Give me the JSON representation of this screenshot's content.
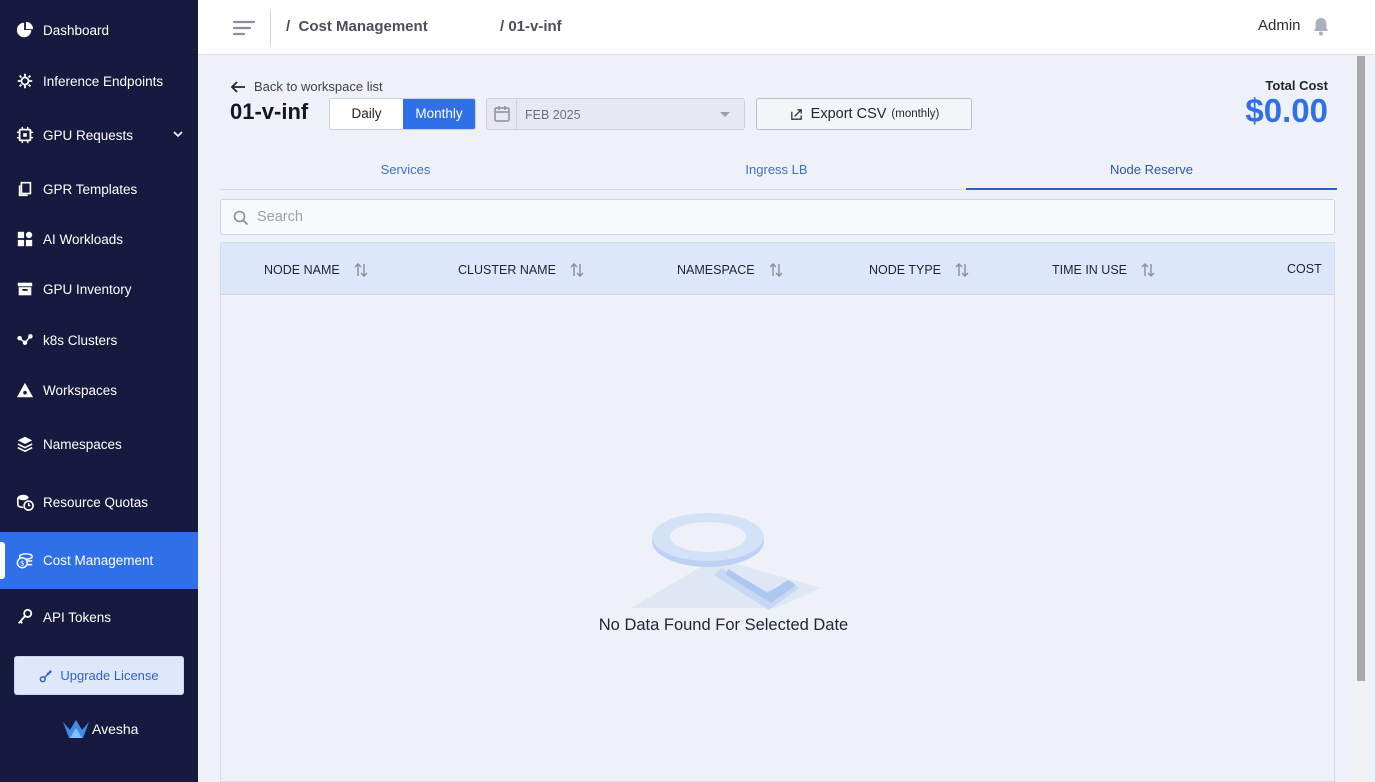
{
  "sidebar": {
    "items": [
      {
        "label": "Dashboard",
        "icon": "pie-chart-icon"
      },
      {
        "label": "Inference Endpoints",
        "icon": "chip-gear-icon"
      },
      {
        "label": "GPU Requests",
        "icon": "cpu-icon"
      },
      {
        "label": "GPR Templates",
        "icon": "copy-icon"
      },
      {
        "label": "AI Workloads",
        "icon": "grid-icon"
      },
      {
        "label": "GPU Inventory",
        "icon": "archive-icon"
      },
      {
        "label": "k8s Clusters",
        "icon": "nodes-icon"
      },
      {
        "label": "Workspaces",
        "icon": "tent-icon"
      },
      {
        "label": "Namespaces",
        "icon": "layers-icon"
      },
      {
        "label": "Resource Quotas",
        "icon": "coins-clock-icon"
      },
      {
        "label": "Cost Management",
        "icon": "money-icon"
      },
      {
        "label": "API Tokens",
        "icon": "key-icon"
      }
    ],
    "active": "Cost Management",
    "upgrade_label": "Upgrade License",
    "brand": "Avesha"
  },
  "header": {
    "crumb1": "/  Cost Management",
    "crumb2": "/ 01-v-inf",
    "user": "Admin"
  },
  "main": {
    "back_label": "Back to workspace list",
    "workspace": "01-v-inf",
    "toggle": {
      "daily": "Daily",
      "monthly": "Monthly",
      "selected": "Monthly"
    },
    "date_value": "FEB 2025",
    "export_label": "Export CSV",
    "export_sub": "(monthly)",
    "total_cost_label": "Total Cost",
    "total_cost_value": "$0.00",
    "tabs": [
      {
        "label": "Services"
      },
      {
        "label": "Ingress LB"
      },
      {
        "label": "Node Reserve"
      }
    ],
    "active_tab": "Node Reserve",
    "search_placeholder": "Search",
    "columns": [
      "NODE NAME",
      "CLUSTER NAME",
      "NAMESPACE",
      "NODE TYPE",
      "TIME IN USE",
      "COST"
    ],
    "empty_text": "No Data Found For Selected Date"
  },
  "colors": {
    "sidebar_bg": "#161a3e",
    "accent": "#2f6fe8",
    "cost_value": "#2f6fe8"
  }
}
